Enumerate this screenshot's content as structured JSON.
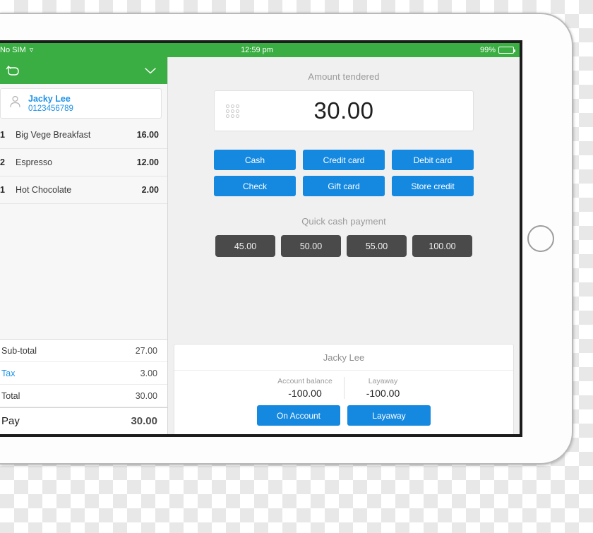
{
  "status_bar": {
    "carrier": "No SIM",
    "wifi_icon": "wifi-icon",
    "time": "12:59 pm",
    "battery_percent": "99%",
    "battery_icon": "battery-icon"
  },
  "sidebar": {
    "header": {
      "back_icon": "undo-arrow-icon",
      "collapse_icon": "chevron-down-icon"
    },
    "customer": {
      "avatar_icon": "person-icon",
      "name": "Jacky Lee",
      "phone": "0123456789"
    },
    "items": [
      {
        "qty": "1",
        "name": "Big Vege Breakfast",
        "price": "16.00"
      },
      {
        "qty": "2",
        "name": "Espresso",
        "price": "12.00"
      },
      {
        "qty": "1",
        "name": "Hot Chocolate",
        "price": "2.00"
      }
    ],
    "totals": [
      {
        "label": "Sub-total",
        "value": "27.00",
        "is_link": false,
        "is_pay": false
      },
      {
        "label": "Tax",
        "value": "3.00",
        "is_link": true,
        "is_pay": false
      },
      {
        "label": "Total",
        "value": "30.00",
        "is_link": false,
        "is_pay": false
      },
      {
        "label": "Pay",
        "value": "30.00",
        "is_link": false,
        "is_pay": true
      }
    ]
  },
  "main": {
    "tender_label": "Amount tendered",
    "tender_amount": "30.00",
    "keypad_icon": "keypad-grid-icon",
    "payment_methods": [
      "Cash",
      "Credit card",
      "Debit card",
      "Check",
      "Gift card",
      "Store credit"
    ],
    "quick_cash_label": "Quick cash payment",
    "quick_cash_amounts": [
      "45.00",
      "50.00",
      "55.00",
      "100.00"
    ]
  },
  "customer_panel": {
    "title": "Jacky Lee",
    "stats": [
      {
        "label": "Account balance",
        "value": "-100.00"
      },
      {
        "label": "Layaway",
        "value": "-100.00"
      }
    ],
    "actions": [
      "On Account",
      "Layaway"
    ]
  },
  "colors": {
    "green_header": "#3aae42",
    "blue_action": "#1589e0",
    "dark_quick_cash": "#4a4a4a",
    "link_blue": "#1d92e8"
  }
}
